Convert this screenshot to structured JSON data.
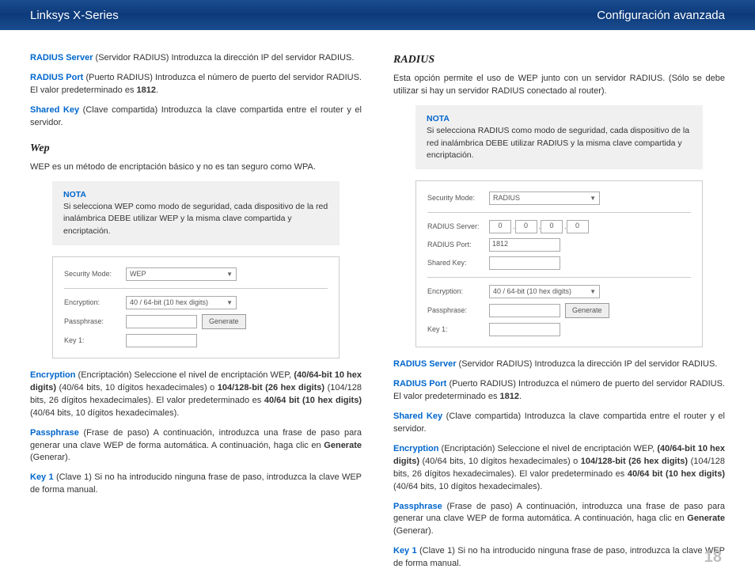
{
  "header": {
    "left": "Linksys X-Series",
    "right": "Configuración avanzada"
  },
  "left": {
    "p1": {
      "term": "RADIUS Server",
      "text": " (Servidor RADIUS) Introduzca la dirección IP del servidor RADIUS."
    },
    "p2": {
      "term": "RADIUS Port",
      "text": " (Puerto RADIUS) Introduzca el número de puerto del servidor RADIUS. El valor predeterminado es ",
      "bold": "1812",
      "tail": "."
    },
    "p3": {
      "term": "Shared Key",
      "text": " (Clave compartida) Introduzca la clave compartida entre el router y el servidor."
    },
    "wep_heading": "Wep",
    "wep_intro": "WEP es un método de encriptación básico y no es tan seguro como WPA.",
    "note": {
      "label": "NOTA",
      "text": "Si selecciona WEP como modo de seguridad, cada dispositivo de la red inalámbrica DEBE utilizar WEP y la misma clave compartida y encriptación."
    },
    "ss": {
      "sec_mode_label": "Security Mode:",
      "sec_mode_value": "WEP",
      "enc_label": "Encryption:",
      "enc_value": "40 / 64-bit (10 hex digits)",
      "pass_label": "Passphrase:",
      "gen_btn": "Generate",
      "key1_label": "Key 1:"
    },
    "p4": {
      "term": "Encryption",
      "t1": " (Encriptación) Seleccione el nivel de encriptación WEP, ",
      "b1": "(40/64-bit 10 hex digits)",
      "t2": " (40/64 bits, 10 dígitos hexadecimales) o ",
      "b2": "104/128-bit (26 hex digits)",
      "t3": " (104/128 bits, 26 dígitos hexadecimales). El valor predeterminado es ",
      "b3": "40/64 bit (10 hex digits)",
      "t4": " (40/64 bits, 10 dígitos hexadecimales)."
    },
    "p5": {
      "term": "Passphrase",
      "t1": " (Frase de paso) A continuación, introduzca una frase de paso para generar una clave WEP de forma automática. A continuación, haga clic en ",
      "b1": "Generate",
      "t2": " (Generar)."
    },
    "p6": {
      "term": "Key 1",
      "text": " (Clave 1) Si no ha introducido ninguna frase de paso, introduzca la clave WEP de forma manual."
    }
  },
  "right": {
    "radius_heading": "RADIUS",
    "radius_intro": "Esta opción permite el uso de WEP junto con un servidor RADIUS. (Sólo se debe utilizar si hay un servidor RADIUS conectado al router).",
    "note": {
      "label": "NOTA",
      "text": "Si selecciona RADIUS como modo de seguridad, cada dispositivo de la red inalámbrica DEBE utilizar RADIUS y la misma clave compartida y encriptación."
    },
    "ss": {
      "sec_mode_label": "Security Mode:",
      "sec_mode_value": "RADIUS",
      "rserver_label": "RADIUS Server:",
      "oct1": "0",
      "oct2": "0",
      "oct3": "0",
      "oct4": "0",
      "rport_label": "RADIUS Port:",
      "rport_value": "1812",
      "skey_label": "Shared Key:",
      "enc_label": "Encryption:",
      "enc_value": "40 / 64-bit (10 hex digits)",
      "pass_label": "Passphrase:",
      "gen_btn": "Generate",
      "key1_label": "Key 1:"
    },
    "p1": {
      "term": "RADIUS Server",
      "text": " (Servidor RADIUS) Introduzca la dirección IP del servidor RADIUS."
    },
    "p2": {
      "term": "RADIUS Port",
      "text": " (Puerto RADIUS) Introduzca el número de puerto del servidor RADIUS. El valor predeterminado es ",
      "bold": "1812",
      "tail": "."
    },
    "p3": {
      "term": "Shared Key",
      "text": " (Clave compartida) Introduzca la clave compartida entre el router y el servidor."
    },
    "p4": {
      "term": "Encryption",
      "t1": " (Encriptación) Seleccione el nivel de encriptación WEP, ",
      "b1": "(40/64-bit 10 hex digits)",
      "t2": " (40/64 bits, 10 dígitos hexadecimales) o ",
      "b2": "104/128-bit (26 hex digits)",
      "t3": " (104/128 bits, 26 dígitos hexadecimales). El valor predeterminado es ",
      "b3": "40/64 bit (10 hex digits)",
      "t4": " (40/64 bits, 10 dígitos hexadecimales)."
    },
    "p5": {
      "term": "Passphrase",
      "t1": " (Frase de paso) A continuación, introduzca una frase de paso para generar una clave WEP de forma automática. A continuación, haga clic en ",
      "b1": "Generate",
      "t2": " (Generar)."
    },
    "p6": {
      "term": "Key 1",
      "text": " (Clave 1) Si no ha introducido ninguna frase de paso, introduzca la clave WEP de forma manual."
    }
  },
  "page_number": "18"
}
